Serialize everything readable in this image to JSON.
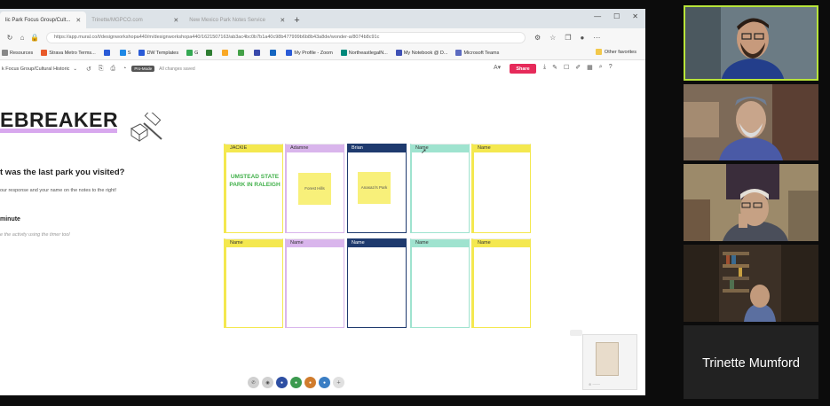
{
  "browser": {
    "tabs": [
      {
        "label": "lic Park Focus Group/Cult...",
        "active": true
      },
      {
        "label": "Trinette/MGPCO.com",
        "active": false
      },
      {
        "label": "New Mexico Park Notes Service",
        "active": false
      }
    ],
    "new_tab": "+",
    "url": "https://app.mural.co/t/designworkshopa440/m/designworkshopa440/1621507163/ab3ac4bc0b7b1a40c98b477999b6b8b43a8de/wonder-a/8074b8c91c",
    "bookmarks": [
      {
        "label": "Resources",
        "color": "#888888"
      },
      {
        "label": "Strava Metro Terms...",
        "color": "#e85a2a"
      },
      {
        "label": "",
        "color": "#2a5bd7"
      },
      {
        "label": "S",
        "color": "#1e88e5"
      },
      {
        "label": "DW Templates",
        "color": "#2a5bd7"
      },
      {
        "label": "G",
        "color": "#34a853"
      },
      {
        "label": "",
        "color": "#2e7d32"
      },
      {
        "label": "",
        "color": "#f9a825"
      },
      {
        "label": "",
        "color": "#43a047"
      },
      {
        "label": "",
        "color": "#3949ab"
      },
      {
        "label": "",
        "color": "#1565c0"
      },
      {
        "label": "My Profile - Zoom",
        "color": "#2a5bd7"
      },
      {
        "label": "NortheastlegalN...",
        "color": "#00897b"
      },
      {
        "label": "My Notebook @ D...",
        "color": "#3f51b5"
      },
      {
        "label": "Microsoft Teams",
        "color": "#5c6bc0"
      }
    ],
    "other_favorites": "Other favorites"
  },
  "mural": {
    "board_name": "k Focus Group/Cultural Historic",
    "badge": "Pro-Mode",
    "saved": "All changes saved",
    "share_label": "Share"
  },
  "content": {
    "title": "EBREAKER",
    "question": "t was the last park you visited?",
    "instructions": "our response and your name on the notes to the right!",
    "minute": "minute",
    "timer_note": "e the activity using the timer tool"
  },
  "cards": [
    {
      "header": "JACKIE",
      "color": "yellow",
      "text": "UMSTEAD STATE PARK IN RALEIGH",
      "sticky": ""
    },
    {
      "header": "Adamne",
      "color": "purple",
      "text": "",
      "sticky": "Forest Hills"
    },
    {
      "header": "Brian",
      "color": "navy",
      "text": "",
      "sticky": "Anasazi's Park"
    },
    {
      "header": "Name",
      "color": "teal",
      "text": "",
      "sticky": ""
    },
    {
      "header": "Name",
      "color": "yellow",
      "text": "",
      "sticky": ""
    },
    {
      "header": "Name",
      "color": "yellow",
      "text": "",
      "sticky": ""
    },
    {
      "header": "Name",
      "color": "purple",
      "text": "",
      "sticky": ""
    },
    {
      "header": "Name",
      "color": "navy",
      "text": "",
      "sticky": ""
    },
    {
      "header": "Name",
      "color": "teal",
      "text": "",
      "sticky": ""
    },
    {
      "header": "Name",
      "color": "yellow",
      "text": "",
      "sticky": ""
    }
  ],
  "zoom_toolbar": [
    {
      "icon": "phone-icon",
      "color": "#d0d0d0"
    },
    {
      "icon": "pointer-icon",
      "color": "#d0d0d0"
    },
    {
      "icon": "participant-avatar-icon",
      "color": "#2e4fa3"
    },
    {
      "icon": "participant-avatar-icon",
      "color": "#3c9a4f"
    },
    {
      "icon": "participant-avatar-icon",
      "color": "#d07c2d"
    },
    {
      "icon": "participant-avatar-icon",
      "color": "#3a7ec4"
    },
    {
      "icon": "more-icon",
      "color": "#e0e0e0"
    }
  ],
  "participants": [
    {
      "name": "",
      "video": true
    },
    {
      "name": "",
      "video": true
    },
    {
      "name": "",
      "video": true
    },
    {
      "name": "",
      "video": true
    },
    {
      "name": "Trinette Mumford",
      "video": false
    }
  ]
}
